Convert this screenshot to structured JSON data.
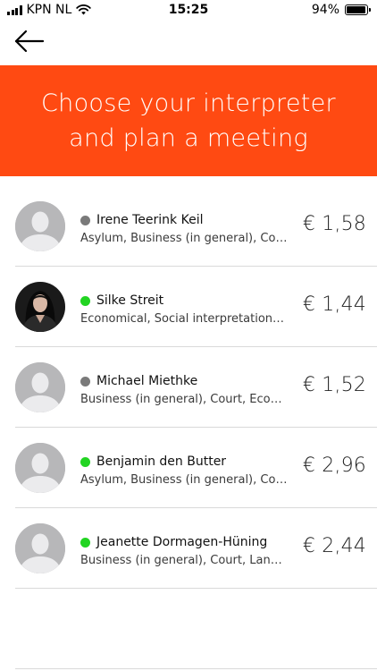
{
  "status_bar": {
    "carrier": "KPN NL",
    "time": "15:25",
    "battery": "94%",
    "battery_level": 0.94,
    "icons": [
      "signal-icon",
      "wifi-icon",
      "battery-icon"
    ]
  },
  "nav": {
    "back_icon": "arrow-left-icon"
  },
  "banner": {
    "line1": "Choose your interpreter",
    "line2": "and plan a meeting",
    "color": "#ff4a12"
  },
  "status_colors": {
    "online": "#22d422",
    "offline": "#7a7a7a"
  },
  "interpreters": [
    {
      "name": "Irene Teerink Keil",
      "skills": "Asylum, Business (in general), Court, Economical",
      "price": "€ 1,58",
      "status": "offline",
      "avatar": "placeholder"
    },
    {
      "name": "Silke Streit",
      "skills": "Economical, Social interpretation, Sales",
      "price": "€ 1,44",
      "status": "online",
      "avatar": "photo"
    },
    {
      "name": "Michael Miethke",
      "skills": "Business (in general), Court, Economical",
      "price": "€ 1,52",
      "status": "offline",
      "avatar": "placeholder"
    },
    {
      "name": "Benjamin den Butter",
      "skills": "Asylum, Business (in general), Court, Economical",
      "price": "€ 2,96",
      "status": "online",
      "avatar": "placeholder"
    },
    {
      "name": "Jeanette Dormagen-Hüning",
      "skills": "Business (in general), Court, Language",
      "price": "€ 2,44",
      "status": "online",
      "avatar": "placeholder"
    }
  ]
}
